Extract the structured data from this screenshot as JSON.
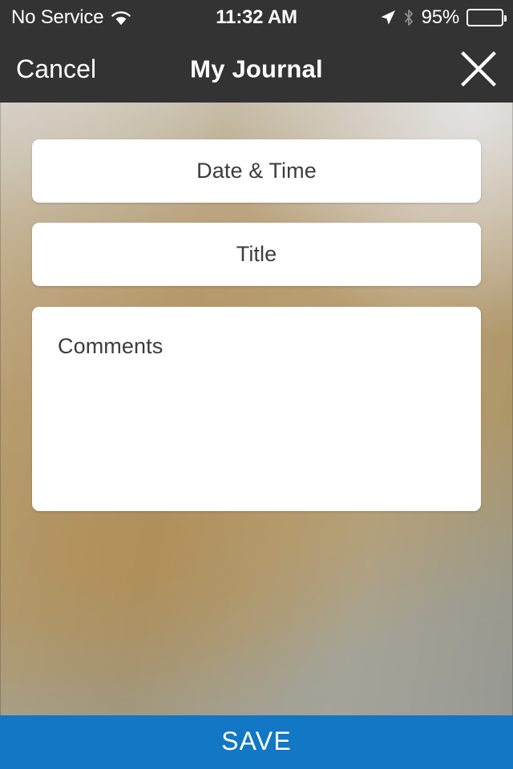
{
  "status_bar": {
    "carrier": "No Service",
    "wifi_icon": "wifi-icon",
    "time": "11:32 AM",
    "location_icon": "location-arrow-icon",
    "bluetooth_icon": "bluetooth-icon",
    "battery_percent": "95%",
    "battery_icon": "battery-icon",
    "battery_level": 95,
    "background_color": "#333333",
    "text_color": "#FFFFFF"
  },
  "nav_bar": {
    "cancel_label": "Cancel",
    "title": "My Journal",
    "close_icon": "close-x-icon",
    "background_color": "#333333"
  },
  "form": {
    "date_time_field": {
      "placeholder": "Date & Time",
      "value": ""
    },
    "title_field": {
      "placeholder": "Title",
      "value": ""
    },
    "comments_field": {
      "placeholder": "Comments",
      "value": ""
    }
  },
  "footer": {
    "save_label": "SAVE",
    "save_color": "#1277C4"
  },
  "theme": {
    "card_background": "#FFFFFF",
    "field_text_color": "#3C3C3C",
    "wallpaper_top_color": "#D3CEC4",
    "wallpaper_mid_color": "#AD9467",
    "wallpaper_bottom_color": "#989A94"
  }
}
